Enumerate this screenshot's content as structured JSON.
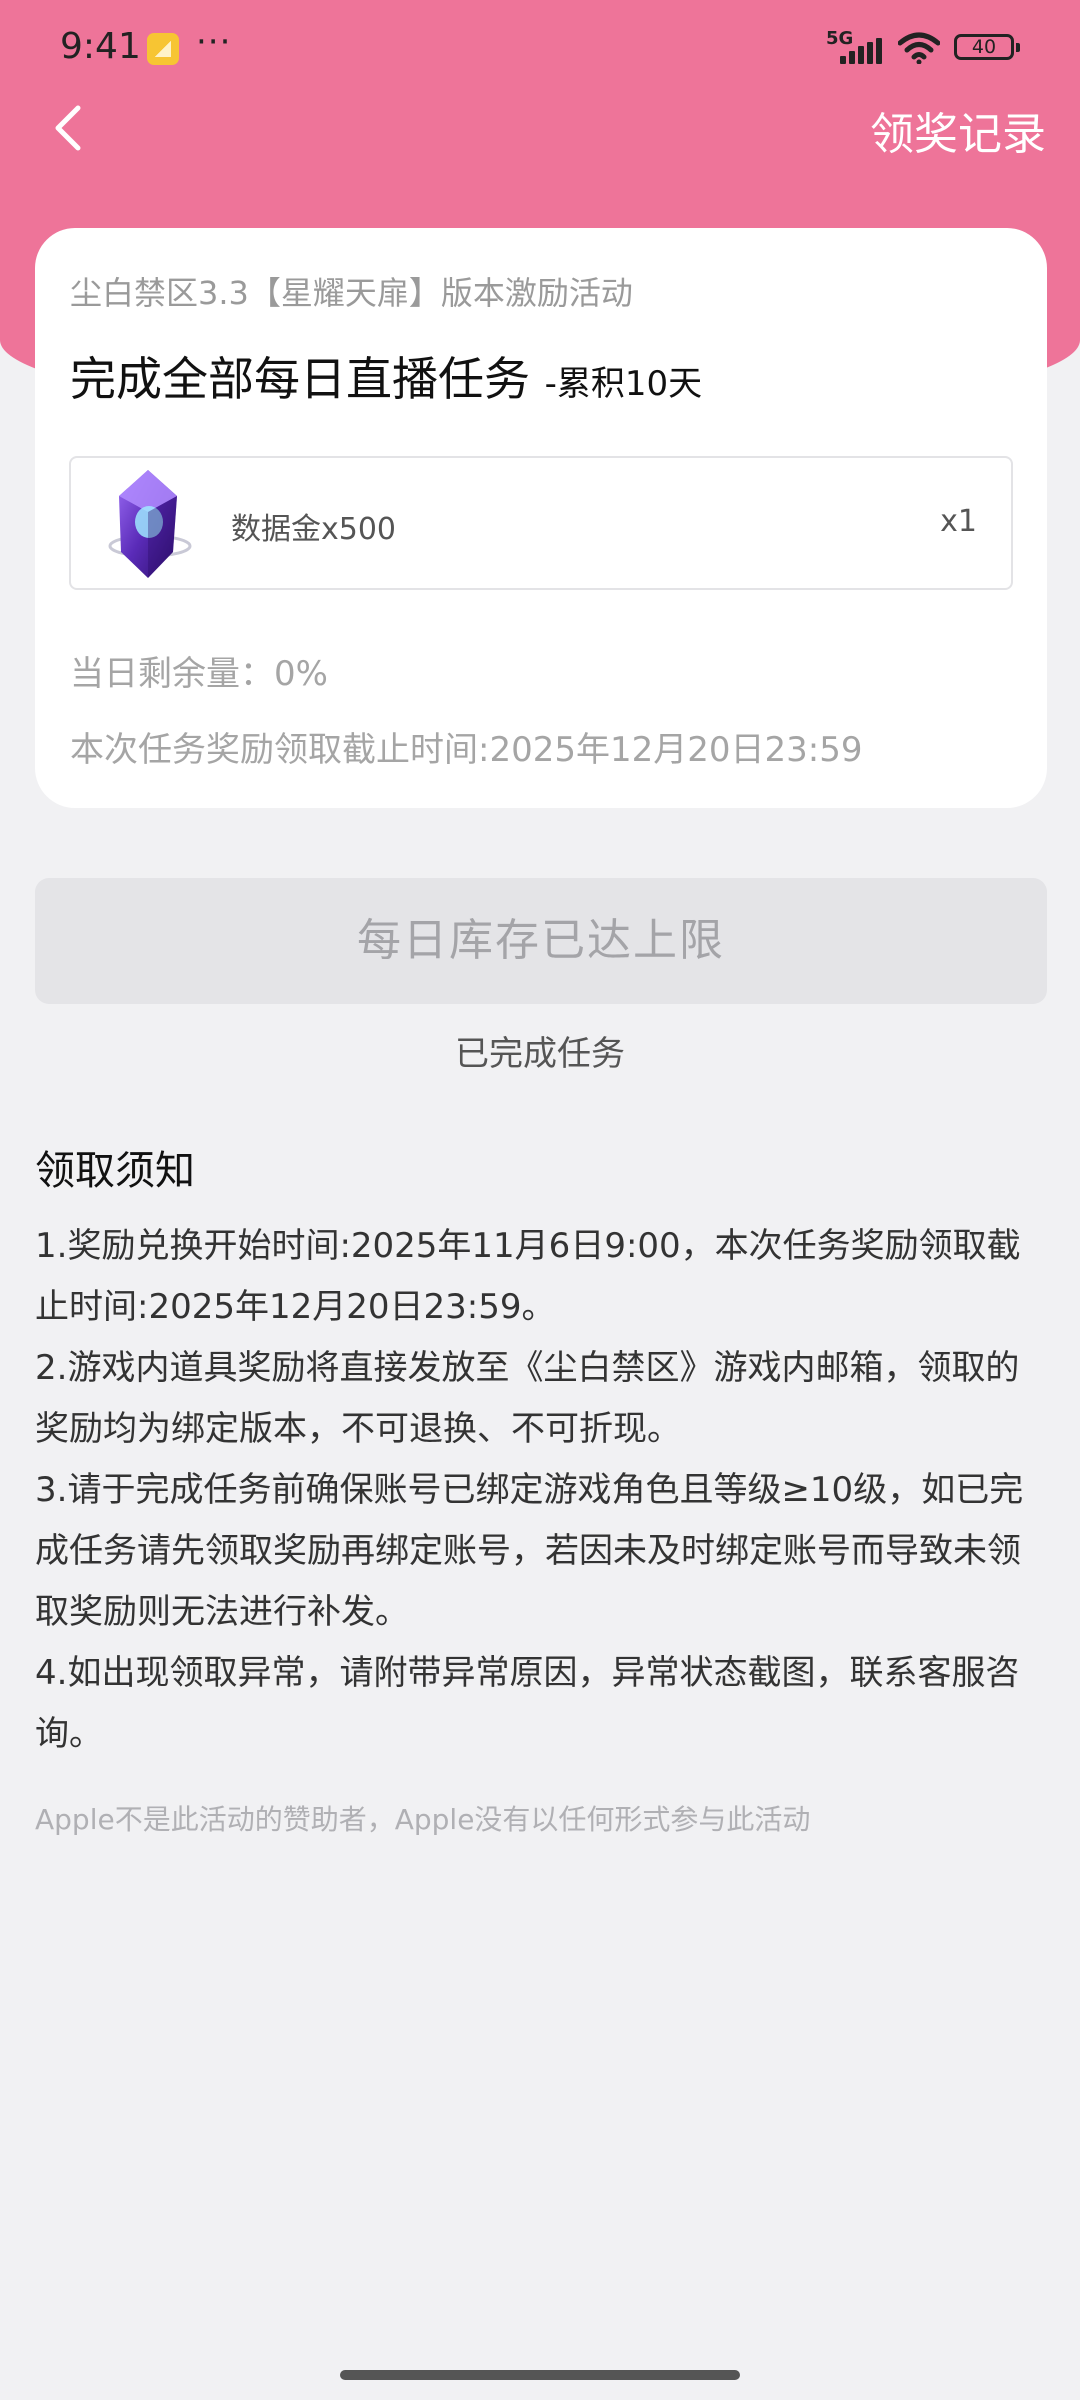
{
  "status_bar": {
    "time": "9:41",
    "dots": "···",
    "network": "5G",
    "battery": "40"
  },
  "header": {
    "records_label": "领奖记录",
    "accent_color": "#ee7499"
  },
  "card": {
    "subtitle": "尘白禁区3.3【星耀天扉】版本激励活动",
    "title": "完成全部每日直播任务",
    "title_suffix": "-累积10天",
    "reward": {
      "icon": "purple-crystal-icon",
      "name": "数据金x500",
      "quantity": "x1"
    },
    "remaining": "当日剩余量：0%",
    "deadline": "本次任务奖励领取截止时间:2025年12月20日23:59"
  },
  "claim_button": {
    "label": "每日库存已达上限"
  },
  "task_status": "已完成任务",
  "notice": {
    "title": "领取须知",
    "items": [
      "1.奖励兑换开始时间:2025年11月6日9:00，本次任务奖励领取截止时间:2025年12月20日23:59。",
      "2.游戏内道具奖励将直接发放至《尘白禁区》游戏内邮箱，领取的奖励均为绑定版本，不可退换、不可折现。",
      "3.请于完成任务前确保账号已绑定游戏角色且等级≥10级，如已完成任务请先领取奖励再绑定账号，若因未及时绑定账号而导致未领取奖励则无法进行补发。",
      "4.如出现领取异常，请附带异常原因，异常状态截图，联系客服咨询。"
    ]
  },
  "disclaimer": "Apple不是此活动的赞助者，Apple没有以任何形式参与此活动"
}
